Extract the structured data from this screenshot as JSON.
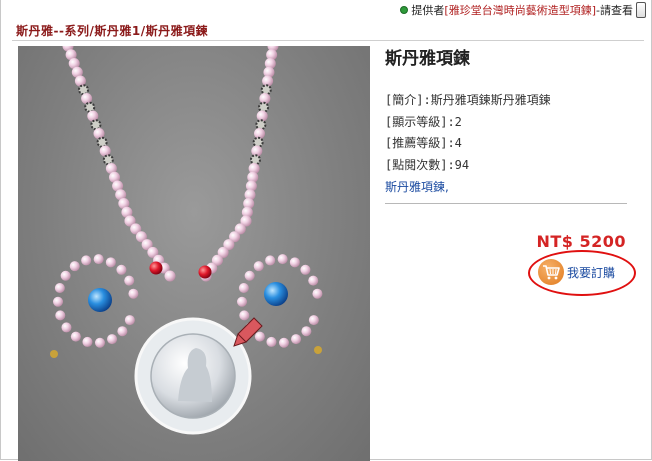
{
  "header": {
    "provider_label": "提供者",
    "shop_name": "[雅珍堂台灣時尚藝術造型項鍊]",
    "provider_suffix": "-請查看"
  },
  "breadcrumb": "斯丹雅--系列/斯丹雅1/斯丹雅項鍊",
  "product": {
    "title": "斯丹雅項鍊",
    "intro": "[簡介]:斯丹雅項鍊斯丹雅項鍊",
    "display_level": "[顯示等級]:2",
    "recommend_level": "[推薦等級]:4",
    "views": "[點閱次數]:94",
    "tags": "斯丹雅項鍊,",
    "price": "NT$ 5200",
    "order_label": "我要訂購"
  },
  "colors": {
    "brand_red": "#8b1a1a",
    "price_red": "#d42424",
    "link_blue": "#1a4aa0",
    "highlight_ring": "#e01010",
    "cart_orange": "#e07a1e"
  },
  "icons": {
    "provider": "green-dot-icon",
    "order": "shopping-cart-icon",
    "scroll": "scroll-cap-icon"
  }
}
